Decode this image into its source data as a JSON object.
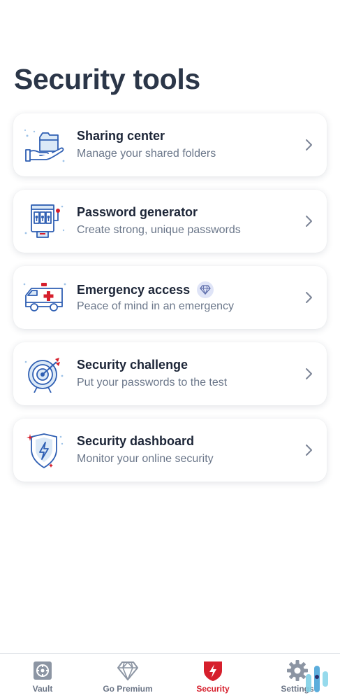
{
  "page": {
    "title": "Security tools"
  },
  "tools": [
    {
      "title": "Sharing center",
      "subtitle": "Manage your shared folders",
      "icon": "sharing-hand-folder-icon"
    },
    {
      "title": "Password generator",
      "subtitle": "Create strong, unique passwords",
      "icon": "password-slot-machine-icon"
    },
    {
      "title": "Emergency access",
      "subtitle": "Peace of mind in an emergency",
      "icon": "ambulance-icon",
      "premium": true
    },
    {
      "title": "Security challenge",
      "subtitle": "Put your passwords to the test",
      "icon": "target-arrow-icon"
    },
    {
      "title": "Security dashboard",
      "subtitle": "Monitor your online security",
      "icon": "shield-bolt-icon"
    }
  ],
  "tabbar": {
    "tabs": [
      {
        "label": "Vault",
        "icon": "safe-icon",
        "active": false
      },
      {
        "label": "Go Premium",
        "icon": "diamond-icon",
        "active": false
      },
      {
        "label": "Security",
        "icon": "shield-bolt-icon",
        "active": true
      },
      {
        "label": "Settings",
        "icon": "gear-icon",
        "active": false
      }
    ]
  },
  "colors": {
    "title": "#2b3648",
    "subtitle": "#6b778a",
    "accent_red": "#d61f2c",
    "icon_blue": "#2f5fb3",
    "icon_light_blue": "#9fc3e8",
    "premium_badge": "#dfe4f7"
  }
}
